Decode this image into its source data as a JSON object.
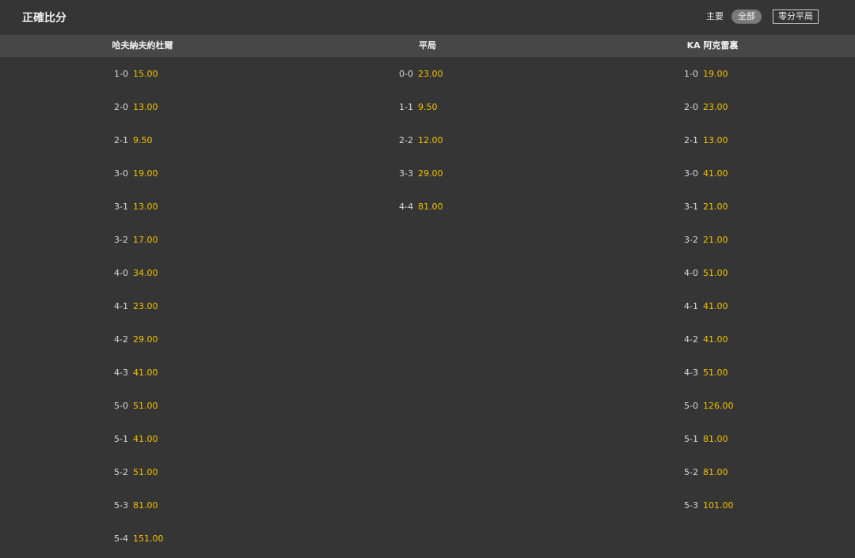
{
  "page": {
    "title": "正確比分",
    "filters": {
      "label": "主要",
      "options": [
        {
          "label": "全部",
          "selected": true
        },
        {
          "label": "零分平局",
          "selected": false
        }
      ]
    }
  },
  "table": {
    "headers": [
      "哈夫納夫約杜爾",
      "平局",
      "KA 阿克雷裏"
    ],
    "columns": [
      [
        {
          "score": "1-0",
          "odds": "15.00"
        },
        {
          "score": "2-0",
          "odds": "13.00"
        },
        {
          "score": "2-1",
          "odds": "9.50"
        },
        {
          "score": "3-0",
          "odds": "19.00"
        },
        {
          "score": "3-1",
          "odds": "13.00"
        },
        {
          "score": "3-2",
          "odds": "17.00"
        },
        {
          "score": "4-0",
          "odds": "34.00"
        },
        {
          "score": "4-1",
          "odds": "23.00"
        },
        {
          "score": "4-2",
          "odds": "29.00"
        },
        {
          "score": "4-3",
          "odds": "41.00"
        },
        {
          "score": "5-0",
          "odds": "51.00"
        },
        {
          "score": "5-1",
          "odds": "41.00"
        },
        {
          "score": "5-2",
          "odds": "51.00"
        },
        {
          "score": "5-3",
          "odds": "81.00"
        },
        {
          "score": "5-4",
          "odds": "151.00"
        }
      ],
      [
        {
          "score": "0-0",
          "odds": "23.00"
        },
        {
          "score": "1-1",
          "odds": "9.50"
        },
        {
          "score": "2-2",
          "odds": "12.00"
        },
        {
          "score": "3-3",
          "odds": "29.00"
        },
        {
          "score": "4-4",
          "odds": "81.00"
        }
      ],
      [
        {
          "score": "1-0",
          "odds": "19.00"
        },
        {
          "score": "2-0",
          "odds": "23.00"
        },
        {
          "score": "2-1",
          "odds": "13.00"
        },
        {
          "score": "3-0",
          "odds": "41.00"
        },
        {
          "score": "3-1",
          "odds": "21.00"
        },
        {
          "score": "3-2",
          "odds": "21.00"
        },
        {
          "score": "4-0",
          "odds": "51.00"
        },
        {
          "score": "4-1",
          "odds": "41.00"
        },
        {
          "score": "4-2",
          "odds": "41.00"
        },
        {
          "score": "4-3",
          "odds": "51.00"
        },
        {
          "score": "5-0",
          "odds": "126.00"
        },
        {
          "score": "5-1",
          "odds": "81.00"
        },
        {
          "score": "5-2",
          "odds": "81.00"
        },
        {
          "score": "5-3",
          "odds": "101.00"
        }
      ]
    ]
  }
}
